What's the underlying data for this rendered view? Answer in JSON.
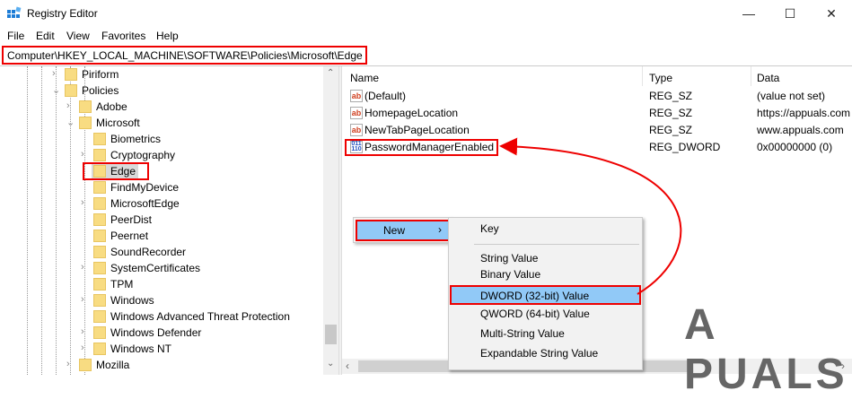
{
  "window": {
    "title": "Registry Editor",
    "minimize": "—",
    "maximize": "☐",
    "close": "✕"
  },
  "menu": [
    "File",
    "Edit",
    "View",
    "Favorites",
    "Help"
  ],
  "address": "Computer\\HKEY_LOCAL_MACHINE\\SOFTWARE\\Policies\\Microsoft\\Edge",
  "tree": [
    {
      "label": "Piriform",
      "level": 0,
      "chev": "›"
    },
    {
      "label": "Policies",
      "level": 0,
      "chev": "⌄"
    },
    {
      "label": "Adobe",
      "level": 1,
      "chev": "›"
    },
    {
      "label": "Microsoft",
      "level": 1,
      "chev": "⌄"
    },
    {
      "label": "Biometrics",
      "level": 2,
      "chev": ""
    },
    {
      "label": "Cryptography",
      "level": 2,
      "chev": "›"
    },
    {
      "label": "Edge",
      "level": 2,
      "chev": "",
      "selected": true
    },
    {
      "label": "FindMyDevice",
      "level": 2,
      "chev": ""
    },
    {
      "label": "MicrosoftEdge",
      "level": 2,
      "chev": "›"
    },
    {
      "label": "PeerDist",
      "level": 2,
      "chev": ""
    },
    {
      "label": "Peernet",
      "level": 2,
      "chev": ""
    },
    {
      "label": "SoundRecorder",
      "level": 2,
      "chev": ""
    },
    {
      "label": "SystemCertificates",
      "level": 2,
      "chev": "›"
    },
    {
      "label": "TPM",
      "level": 2,
      "chev": ""
    },
    {
      "label": "Windows",
      "level": 2,
      "chev": "›"
    },
    {
      "label": "Windows Advanced Threat Protection",
      "level": 2,
      "chev": ""
    },
    {
      "label": "Windows Defender",
      "level": 2,
      "chev": "›"
    },
    {
      "label": "Windows NT",
      "level": 2,
      "chev": "›"
    },
    {
      "label": "Mozilla",
      "level": 1,
      "chev": "›"
    }
  ],
  "columns": {
    "name": "Name",
    "type": "Type",
    "data": "Data"
  },
  "values": [
    {
      "name": "(Default)",
      "type": "REG_SZ",
      "data": "(value not set)",
      "icon": "ab"
    },
    {
      "name": "HomepageLocation",
      "type": "REG_SZ",
      "data": "https://appuals.com",
      "icon": "ab"
    },
    {
      "name": "NewTabPageLocation",
      "type": "REG_SZ",
      "data": "www.appuals.com",
      "icon": "ab"
    },
    {
      "name": "PasswordManagerEnabled",
      "type": "REG_DWORD",
      "data": "0x00000000 (0)",
      "icon": "bin"
    }
  ],
  "context_menu": {
    "new": "New",
    "arrow": "›",
    "items": [
      "Key",
      "String Value",
      "Binary Value",
      "DWORD (32-bit) Value",
      "QWORD (64-bit) Value",
      "Multi-String Value",
      "Expandable String Value"
    ]
  },
  "watermark": "A PUALS",
  "colors": {
    "highlight": "#91c9f7",
    "annotation": "#e00000"
  }
}
